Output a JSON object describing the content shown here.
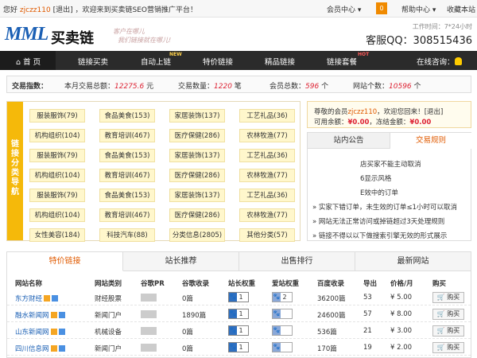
{
  "topbar": {
    "hello": "您好",
    "user": "zjczz110",
    "logout": "[退出]",
    "welcome": "，欢迎来到买卖链SEO营销推广平台！",
    "member_center": "会员中心",
    "notice_count": "0",
    "help_center": "帮助中心",
    "bookmark": "收藏本站"
  },
  "header": {
    "logo_text": "MML",
    "logo_cn": "买卖链",
    "slogan_1": "客户在哪儿",
    "slogan_2": "我们链接就在哪儿!",
    "worktime": "工作时间：7*24小时",
    "qq": "客服QQ：308515436"
  },
  "nav": {
    "items": [
      "首 页",
      "链接买卖",
      "自动上链",
      "特价链接",
      "精品链接",
      "链接套餐"
    ],
    "badge_new": "NEW",
    "badge_hot": "HOT",
    "consult": "在线咨询："
  },
  "stats": {
    "label": "交易指数：",
    "month_label": "本月交易总额：",
    "month_value": "12275.6",
    "month_unit": "元",
    "count_label": "交易数量：",
    "count_value": "1220",
    "count_unit": "笔",
    "members_label": "会员总数：",
    "members_value": "596",
    "members_unit": "个",
    "sites_label": "网站个数：",
    "sites_value": "10596",
    "sites_unit": "个"
  },
  "categories": {
    "label": "链接分类导航",
    "rows": [
      [
        "服装服饰(79)",
        "食品美食(153)",
        "家居装饰(137)",
        "工艺礼品(36)"
      ],
      [
        "机构组织(104)",
        "教育培训(467)",
        "医疗保健(286)",
        "农林牧渔(77)"
      ],
      [
        "服装服饰(79)",
        "食品美食(153)",
        "家居装饰(137)",
        "工艺礼品(36)"
      ],
      [
        "机构组织(104)",
        "教育培训(467)",
        "医疗保健(286)",
        "农林牧渔(77)"
      ],
      [
        "服装服饰(79)",
        "食品美食(153)",
        "家居装饰(137)",
        "工艺礼品(36)"
      ],
      [
        "机构组织(104)",
        "教育培训(467)",
        "医疗保健(286)",
        "农林牧渔(77)"
      ],
      [
        "女性美容(184)",
        "科技汽车(88)",
        "分类信息(2805)",
        "其他分类(57)"
      ]
    ]
  },
  "account": {
    "greet_pre": "尊敬的会员",
    "user": "zjczz110",
    "greet_post": "，欢迎您回来！",
    "logout": "[退出]",
    "balance_label": "可用余额：",
    "balance": "¥0.00",
    "frozen_label": "，冻结金额：",
    "frozen": "¥0.00"
  },
  "rules": {
    "tab_notice": "站内公告",
    "tab_rules": "交易规则",
    "lines": [
      "店买家不能主动取消",
      "6显示风格",
      "E效中的订单",
      "» 实家下错订单，未生效的订单≤1小时可以取消",
      "» 网站无法正常访问或掉链超过3天处理规则",
      "» 链接不得以以下做搜索引擎无效的形式展示"
    ]
  },
  "tabs": [
    "特价链接",
    "站长推荐",
    "出售排行",
    "最新网站"
  ],
  "table": {
    "headers": [
      "网站名称",
      "网站类别",
      "谷歌PR",
      "谷歌收录",
      "站长权重",
      "爱站权重",
      "百度收录",
      "导出",
      "价格/月",
      "购买"
    ],
    "rows": [
      {
        "name": "东方财经",
        "cat": "财经股票",
        "pr": 0,
        "google": "0篇",
        "zz": "1",
        "az": "2",
        "baidu": "36200篇",
        "out": "53",
        "price": "¥ 5.00",
        "buy": "购买"
      },
      {
        "name": "融水新闻网",
        "cat": "新闻门户",
        "pr": 0,
        "google": "1890篇",
        "zz": "1",
        "az": "",
        "baidu": "24600篇",
        "out": "57",
        "price": "¥ 8.00",
        "buy": "购买"
      },
      {
        "name": "山东新闻网",
        "cat": "机械设备",
        "pr": 0,
        "google": "0篇",
        "zz": "1",
        "az": "",
        "baidu": "536篇",
        "out": "21",
        "price": "¥ 3.00",
        "buy": "购买"
      },
      {
        "name": "四川信息网",
        "cat": "新闻门户",
        "pr": 0,
        "google": "0篇",
        "zz": "1",
        "az": "",
        "baidu": "170篇",
        "out": "19",
        "price": "¥ 2.00",
        "buy": "购买"
      }
    ]
  }
}
